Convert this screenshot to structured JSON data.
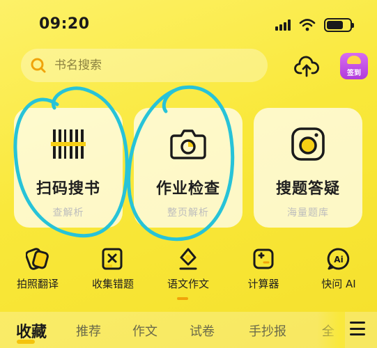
{
  "status_bar": {
    "time": "09:20",
    "battery_level": 0.72,
    "icons": [
      "signal-icon",
      "wifi-icon",
      "battery-icon"
    ]
  },
  "search": {
    "placeholder": "书名搜索",
    "icon": "search-icon"
  },
  "header_actions": {
    "upload_icon": "cloud-upload-icon",
    "checkin_label": "签到"
  },
  "cards": [
    {
      "title": "扫码搜书",
      "subtitle": "查解析",
      "icon": "barcode-icon"
    },
    {
      "title": "作业检查",
      "subtitle": "整页解析",
      "icon": "camera-icon"
    },
    {
      "title": "搜题答疑",
      "subtitle": "海量题库",
      "icon": "camera-lens-icon"
    }
  ],
  "tools": [
    {
      "label": "拍照翻译",
      "icon": "photo-translate-icon"
    },
    {
      "label": "收集错题",
      "icon": "wrong-question-icon"
    },
    {
      "label": "语文作文",
      "icon": "essay-icon"
    },
    {
      "label": "计算器",
      "icon": "calculator-icon"
    },
    {
      "label": "快问 AI",
      "icon": "ai-icon"
    }
  ],
  "tabs": [
    {
      "label": "收藏",
      "active": true
    },
    {
      "label": "推荐",
      "active": false
    },
    {
      "label": "作文",
      "active": false
    },
    {
      "label": "试卷",
      "active": false
    },
    {
      "label": "手抄报",
      "active": false
    },
    {
      "label": "全",
      "active": false
    }
  ],
  "colors": {
    "background": "#f9e83a",
    "accent": "#f4c30c",
    "annotation": "#27c3d8",
    "checkin": "#c04fe6"
  }
}
